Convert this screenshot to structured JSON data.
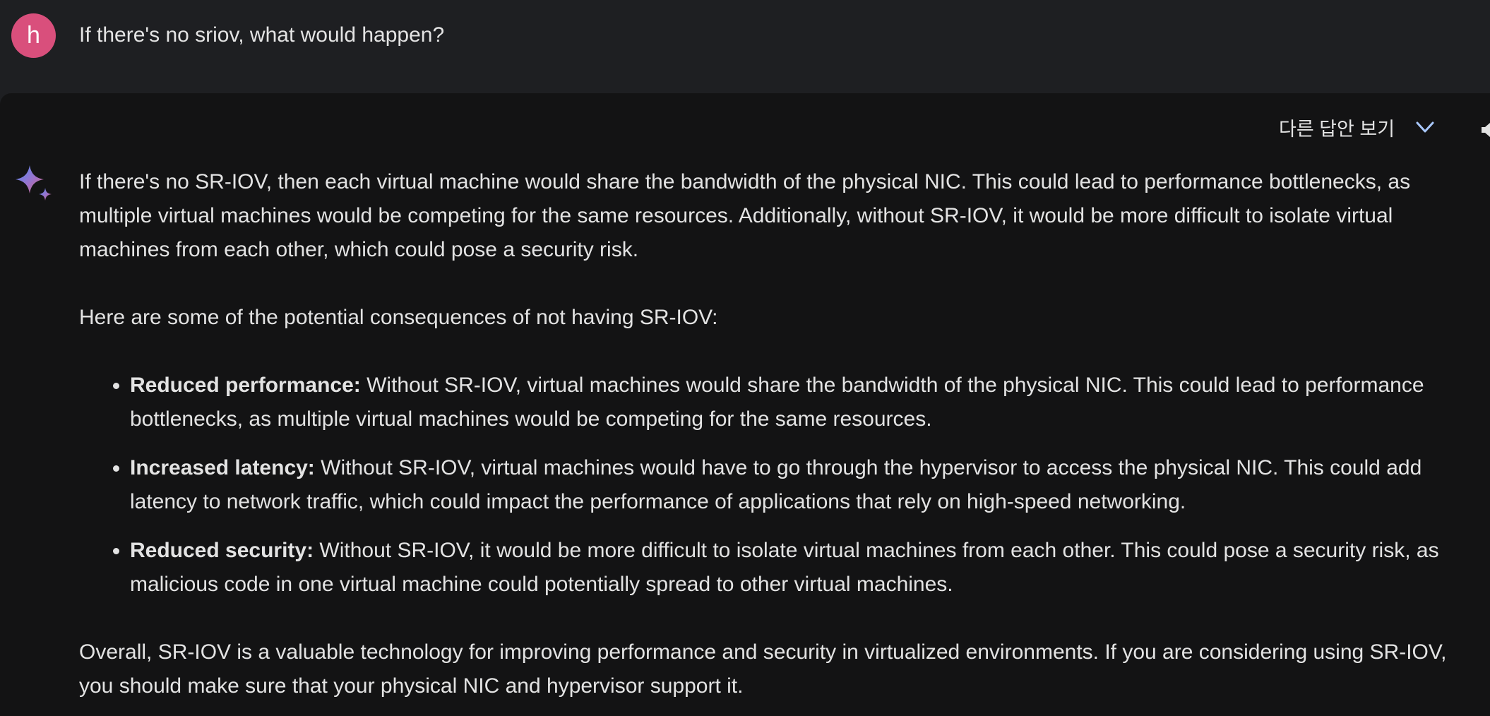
{
  "user": {
    "avatar_letter": "h",
    "prompt": "If there's no sriov, what would happen?"
  },
  "toolbar": {
    "other_drafts_label": "다른 답안 보기"
  },
  "response": {
    "intro": "If there's no SR-IOV, then each virtual machine would share the bandwidth of the physical NIC. This could lead to performance bottlenecks, as multiple virtual machines would be competing for the same resources. Additionally, without SR-IOV, it would be more difficult to isolate virtual machines from each other, which could pose a security risk.",
    "list_intro": "Here are some of the potential consequences of not having SR-IOV:",
    "bullets": [
      {
        "title": "Reduced performance:",
        "text": " Without SR-IOV, virtual machines would share the bandwidth of the physical NIC. This could lead to performance bottlenecks, as multiple virtual machines would be competing for the same resources."
      },
      {
        "title": "Increased latency:",
        "text": " Without SR-IOV, virtual machines would have to go through the hypervisor to access the physical NIC. This could add latency to network traffic, which could impact the performance of applications that rely on high-speed networking."
      },
      {
        "title": "Reduced security:",
        "text": " Without SR-IOV, it would be more difficult to isolate virtual machines from each other. This could pose a security risk, as malicious code in one virtual machine could potentially spread to other virtual machines."
      }
    ],
    "conclusion": "Overall, SR-IOV is a valuable technology for improving performance and security in virtualized environments. If you are considering using SR-IOV, you should make sure that your physical NIC and hypervisor support it."
  },
  "colors": {
    "avatar": "#d94f7c",
    "accent_chevron": "#a8c7fa",
    "panel_bg": "#131314",
    "page_bg": "#1e1f22"
  },
  "icons": {
    "avatar": "avatar",
    "sparkle": "sparkle-icon",
    "chevron": "chevron-down-icon"
  }
}
